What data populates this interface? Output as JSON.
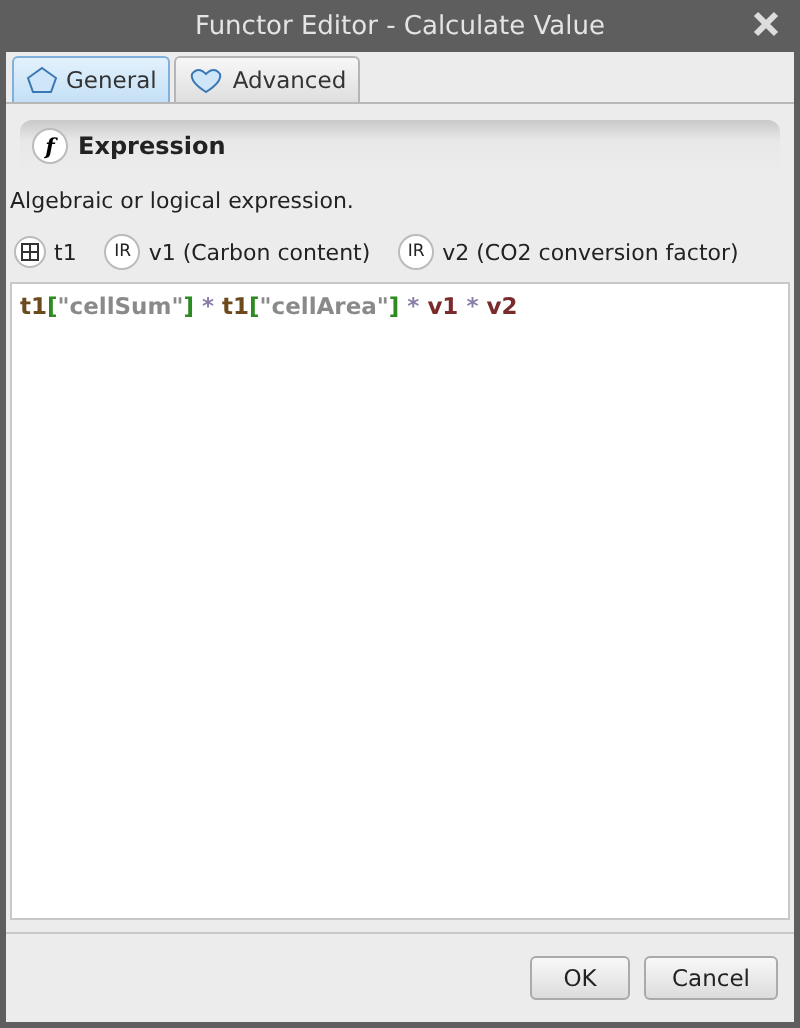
{
  "window": {
    "title": "Functor Editor - Calculate Value"
  },
  "tabs": [
    {
      "label": "General",
      "selected": true,
      "kind": "general"
    },
    {
      "label": "Advanced",
      "selected": false,
      "kind": "advanced"
    }
  ],
  "section": {
    "icon": "f",
    "title": "Expression"
  },
  "description": "Algebraic or logical expression.",
  "variables": [
    {
      "kind": "table",
      "name": "t1"
    },
    {
      "kind": "value",
      "badge": "IR",
      "name": "v1 (Carbon content)"
    },
    {
      "kind": "value",
      "badge": "IR",
      "name": "v2 (CO2 conversion factor)"
    }
  ],
  "expression": [
    {
      "kind": "identifier",
      "text": "t1"
    },
    {
      "kind": "bracket",
      "text": "["
    },
    {
      "kind": "string",
      "text": "\"cellSum\""
    },
    {
      "kind": "bracket",
      "text": "]"
    },
    {
      "kind": "operator",
      "text": " * "
    },
    {
      "kind": "identifier",
      "text": "t1"
    },
    {
      "kind": "bracket",
      "text": "["
    },
    {
      "kind": "string",
      "text": "\"cellArea\""
    },
    {
      "kind": "bracket",
      "text": "]"
    },
    {
      "kind": "operator",
      "text": " * "
    },
    {
      "kind": "variable",
      "text": "v1"
    },
    {
      "kind": "operator",
      "text": " * "
    },
    {
      "kind": "variable",
      "text": "v2"
    }
  ],
  "buttons": [
    {
      "label": "OK"
    },
    {
      "label": "Cancel"
    }
  ]
}
